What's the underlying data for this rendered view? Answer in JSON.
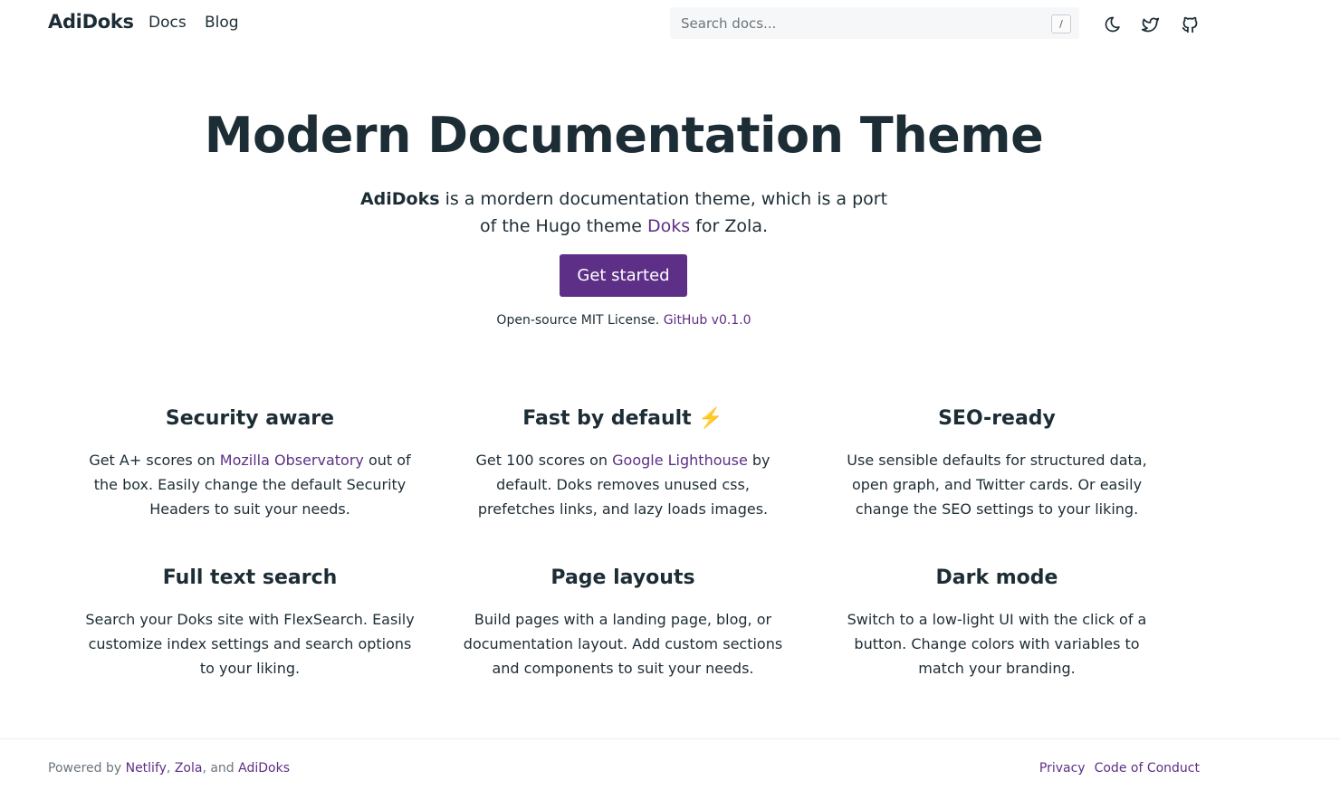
{
  "header": {
    "brand": "AdiDoks",
    "nav": {
      "docs": "Docs",
      "blog": "Blog"
    },
    "search_placeholder": "Search docs...",
    "search_shortcut": "/",
    "icons": [
      "moon-icon",
      "twitter-icon",
      "github-icon"
    ]
  },
  "hero": {
    "title": "Modern Documentation Theme",
    "lead_brand": "AdiDoks",
    "lead_text_1": " is a mordern documentation theme, which is a port of the Hugo theme ",
    "lead_link": "Doks",
    "lead_text_2": " for Zola.",
    "cta": "Get started",
    "license_text": "Open-source MIT License. ",
    "license_link": "GitHub v0.1.0"
  },
  "features": {
    "security": {
      "title": "Security aware",
      "pre": "Get A+ scores on ",
      "link": "Mozilla Observatory",
      "post": " out of the box. Easily change the default Security Headers to suit your needs."
    },
    "fast": {
      "title": "Fast by default ⚡️",
      "pre": "Get 100 scores on ",
      "link": "Google Lighthouse",
      "post": " by default. Doks removes unused css, prefetches links, and lazy loads images."
    },
    "seo": {
      "title": "SEO-ready",
      "text": "Use sensible defaults for structured data, open graph, and Twitter cards. Or easily change the SEO settings to your liking."
    },
    "search": {
      "title": "Full text search",
      "text": "Search your Doks site with FlexSearch. Easily customize index settings and search options to your liking."
    },
    "layouts": {
      "title": "Page layouts",
      "text": "Build pages with a landing page, blog, or documentation layout. Add custom sections and components to suit your needs."
    },
    "dark": {
      "title": "Dark mode",
      "text": "Switch to a low-light UI with the click of a button. Change colors with variables to match your branding."
    }
  },
  "footer": {
    "powered_by": "Powered by ",
    "netlify": "Netlify",
    "sep1": ", ",
    "zola": "Zola",
    "sep2": ", and ",
    "adidoks": "AdiDoks",
    "privacy": "Privacy",
    "coc": "Code of Conduct"
  },
  "colors": {
    "accent": "#5d2f86",
    "text": "#1d2d35",
    "muted": "#6c757d",
    "search_bg": "#f6f7f8"
  }
}
